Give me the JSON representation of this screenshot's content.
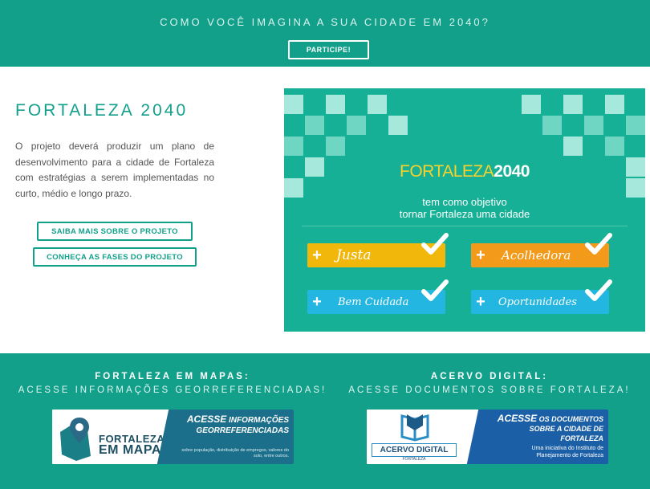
{
  "hero": {
    "tagline": "COMO VOCÊ IMAGINA A SUA CIDADE EM 2040?",
    "cta_label": "PARTICIPE!"
  },
  "intro": {
    "title": "FORTALEZA 2040",
    "text": "O projeto deverá produzir um plano de desenvolvimento para a cidade de Fortaleza com estratégias a serem implementadas no curto, médio e longo prazo.",
    "buttons": [
      "SAIBA MAIS SOBRE O PROJETO",
      "CONHEÇA AS FASES DO PROJETO"
    ]
  },
  "banner": {
    "logo_part1": "FORTALEZA",
    "logo_part2": "2040",
    "objective_line1": "tem como objetivo",
    "objective_line2": "tornar Fortaleza uma cidade",
    "goals": [
      "Justa",
      "Acolhedora",
      "Bem Cuidada",
      "Oportunidades"
    ],
    "colors": {
      "background": "#15b096",
      "yellow": "#f2b70b",
      "orange": "#f39a1a",
      "cyan": "#23b6e0"
    }
  },
  "sections": {
    "mapas": {
      "heading": "FORTALEZA EM MAPAS:",
      "subheading": "ACESSE INFORMAÇÕES GEORREFERENCIADAS!",
      "card_brand_line1": "FORTALEZA",
      "card_brand_line2": "EM MAPAS",
      "card_title_strong": "ACESSE",
      "card_title_rest": "INFORMAÇÕES GEORREFERENCIADAS",
      "card_sub": "sobre população, distribuição de empregos, valores do solo, entre outros."
    },
    "acervo": {
      "heading": "ACERVO DIGITAL:",
      "subheading": "ACESSE DOCUMENTOS SOBRE FORTALEZA!",
      "card_brand": "ACERVO DIGITAL",
      "card_brand_sub": "FORTALEZA",
      "card_title_strong": "ACESSE",
      "card_title_rest": "OS DOCUMENTOS SOBRE A CIDADE DE FORTALEZA",
      "card_sub": "Uma iniciativa do Instituto de Planejamento de Fortaleza"
    }
  },
  "icons": [
    "map-pin-icon",
    "book-icon",
    "plus-icon",
    "check-icon"
  ],
  "colors": {
    "brand": "#12a08b",
    "text": "#555555"
  }
}
